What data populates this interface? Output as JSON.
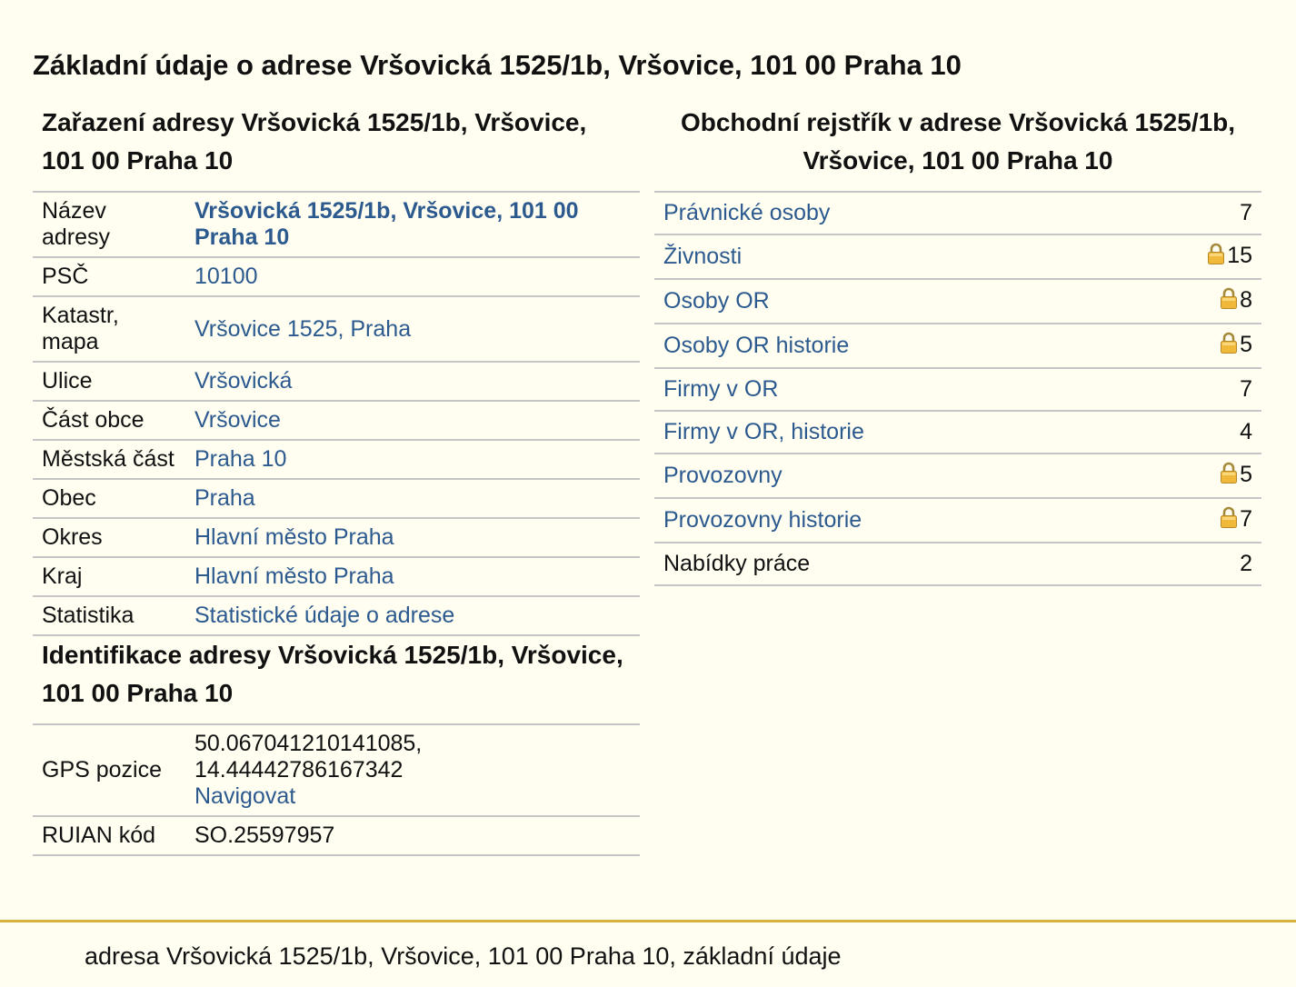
{
  "page": {
    "title": "Základní údaje o adrese Vršovická 1525/1b, Vršovice, 101 00 Praha 10"
  },
  "zarazeni": {
    "heading": "Zařazení adresy Vršovická 1525/1b, Vršovice, 101 00 Praha 10",
    "rows": [
      {
        "label": "Název adresy",
        "value": "Vršovická 1525/1b, Vršovice, 101 00 Praha 10"
      },
      {
        "label": "PSČ",
        "value": "10100"
      },
      {
        "label": "Katastr, mapa",
        "value": "Vršovice 1525, Praha"
      },
      {
        "label": "Ulice",
        "value": "Vršovická"
      },
      {
        "label": "Část obce",
        "value": "Vršovice"
      },
      {
        "label": "Městská část",
        "value": "Praha 10"
      },
      {
        "label": "Obec",
        "value": "Praha"
      },
      {
        "label": "Okres",
        "value": "Hlavní město Praha"
      },
      {
        "label": "Kraj",
        "value": "Hlavní město Praha"
      },
      {
        "label": "Statistika",
        "value": "Statistické údaje o adrese"
      }
    ]
  },
  "identifikace": {
    "heading": "Identifikace adresy Vršovická 1525/1b, Vršovice, 101 00 Praha 10",
    "gps_label": "GPS pozice",
    "gps_lat": "50.067041210141085,",
    "gps_lon": "14.44442786167342",
    "navigate_label": "Navigovat",
    "ruian_label": "RUIAN kód",
    "ruian_value": "SO.25597957"
  },
  "obchodni_rejstrik": {
    "heading": "Obchodní rejstřík v adrese Vršovická 1525/1b, Vršovice, 101 00 Praha 10",
    "rows": [
      {
        "label": "Právnické osoby",
        "count": "7",
        "locked": false,
        "link": true
      },
      {
        "label": "Živnosti",
        "count": "15",
        "locked": true,
        "link": true
      },
      {
        "label": "Osoby OR",
        "count": "8",
        "locked": true,
        "link": true
      },
      {
        "label": "Osoby OR historie",
        "count": "5",
        "locked": true,
        "link": true
      },
      {
        "label": "Firmy v OR",
        "count": "7",
        "locked": false,
        "link": true
      },
      {
        "label": "Firmy v OR, historie",
        "count": "4",
        "locked": false,
        "link": true
      },
      {
        "label": "Provozovny",
        "count": "5",
        "locked": true,
        "link": true
      },
      {
        "label": "Provozovny historie",
        "count": "7",
        "locked": true,
        "link": true
      },
      {
        "label": "Nabídky práce",
        "count": "2",
        "locked": false,
        "link": false
      }
    ]
  },
  "footer": {
    "text": "adresa Vršovická 1525/1b, Vršovice, 101 00 Praha 10, základní údaje"
  },
  "colors": {
    "background": "#fffef1",
    "link": "#2c5a8f",
    "divider": "#c5c5c5",
    "footer_rule": "#d6b13c"
  },
  "icons": {
    "lock": "padlock-icon"
  }
}
